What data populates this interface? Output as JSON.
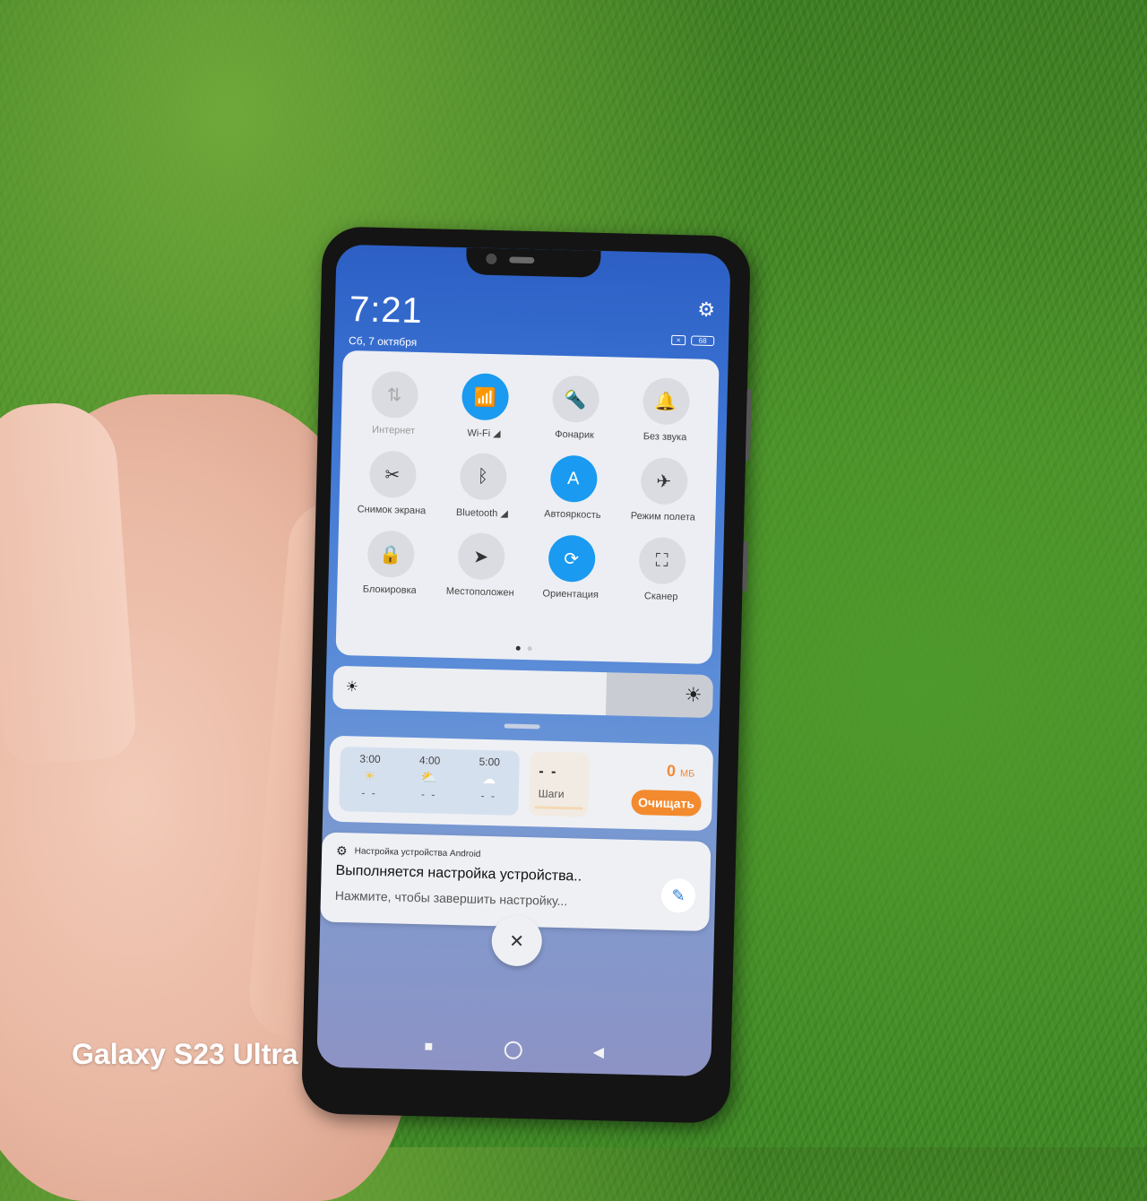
{
  "statusbar": {
    "time": "7:21",
    "date": "Сб, 7 октября",
    "battery_level": "68",
    "settings_icon": "gear-icon",
    "sim_icon": "no-sim-icon"
  },
  "quick_settings": {
    "tiles": [
      {
        "label": "Интернет",
        "icon": "⇅",
        "icon_name": "mobile-data-icon",
        "state": "disabled"
      },
      {
        "label": "Wi-Fi ◢",
        "icon": "📶",
        "icon_name": "wifi-icon",
        "state": "on"
      },
      {
        "label": "Фонарик",
        "icon": "🔦",
        "icon_name": "flashlight-icon",
        "state": "off"
      },
      {
        "label": "Без звука",
        "icon": "🔔",
        "icon_name": "bell-icon",
        "state": "off"
      },
      {
        "label": "Снимок экрана",
        "icon": "✂",
        "icon_name": "screenshot-icon",
        "state": "off"
      },
      {
        "label": "Bluetooth ◢",
        "icon": "ᛒ",
        "icon_name": "bluetooth-icon",
        "state": "off"
      },
      {
        "label": "Автояркость",
        "icon": "A",
        "icon_name": "auto-brightness-icon",
        "state": "on"
      },
      {
        "label": "Режим полета",
        "icon": "✈",
        "icon_name": "airplane-icon",
        "state": "off"
      },
      {
        "label": "Блокировка",
        "icon": "🔒",
        "icon_name": "lock-icon",
        "state": "off"
      },
      {
        "label": "Местоположен",
        "icon": "➤",
        "icon_name": "location-icon",
        "state": "off"
      },
      {
        "label": "Ориентация",
        "icon": "⟳",
        "icon_name": "rotation-lock-icon",
        "state": "on"
      },
      {
        "label": "Сканер",
        "icon": "⛶",
        "icon_name": "scanner-icon",
        "state": "off"
      }
    ],
    "page_count": 2,
    "active_page": 1
  },
  "brightness": {
    "level_percent": 72,
    "low_icon": "☀",
    "high_icon": "☀"
  },
  "widget": {
    "weather": [
      {
        "time": "3:00",
        "icon": "☀",
        "value": "- -"
      },
      {
        "time": "4:00",
        "icon": "⛅",
        "value": "- -"
      },
      {
        "time": "5:00",
        "icon": "☁",
        "value": "- -"
      }
    ],
    "steps_value": "- -",
    "steps_label": "Шаги",
    "memory_value": "0",
    "memory_unit": "МБ",
    "clean_label": "Очищать"
  },
  "notification": {
    "app_name": "Настройка устройства Android",
    "title": "Выполняется настройка устройства..",
    "body": "Нажмите, чтобы завершить настройку...",
    "icon": "✎"
  },
  "close_label": "✕",
  "navbar": {
    "recents": "■",
    "back": "◀"
  },
  "watermark": "Galaxy S23 Ultra",
  "colors": {
    "accent": "#1a9af0",
    "orange": "#f38a2e"
  }
}
